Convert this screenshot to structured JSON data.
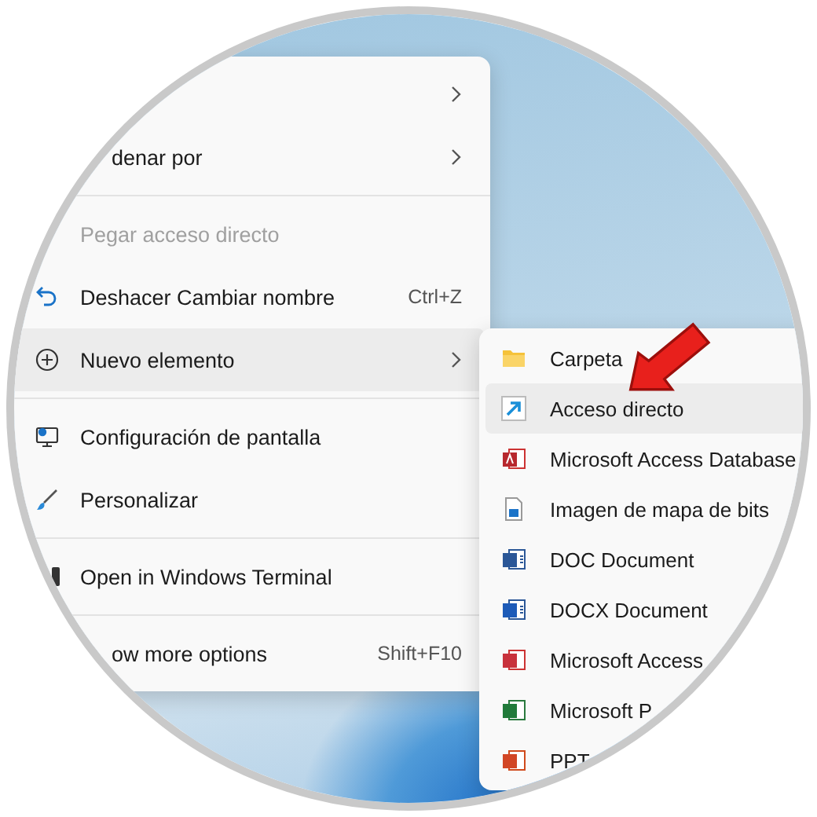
{
  "context_menu": {
    "items": [
      {
        "kind": "item",
        "disabled": false,
        "selected": false,
        "submenu": true
      },
      {
        "kind": "partial",
        "label": "denar por",
        "disabled": false,
        "selected": false,
        "submenu": true
      },
      {
        "kind": "separator"
      },
      {
        "kind": "item",
        "label": "Pegar acceso directo",
        "disabled": true,
        "selected": false,
        "submenu": false
      },
      {
        "kind": "item",
        "label": "Deshacer Cambiar nombre",
        "shortcut": "Ctrl+Z",
        "disabled": false,
        "selected": false,
        "submenu": false
      },
      {
        "kind": "item",
        "label": "Nuevo elemento",
        "disabled": false,
        "selected": true,
        "submenu": true
      },
      {
        "kind": "separator"
      },
      {
        "kind": "item",
        "label": "Configuración de pantalla",
        "disabled": false,
        "selected": false,
        "submenu": false
      },
      {
        "kind": "item",
        "label": "Personalizar",
        "disabled": false,
        "selected": false,
        "submenu": false
      },
      {
        "kind": "separator"
      },
      {
        "kind": "item",
        "label": "Open in Windows Terminal",
        "disabled": false,
        "selected": false,
        "submenu": false
      },
      {
        "kind": "separator"
      },
      {
        "kind": "partial",
        "label": "ow more options",
        "shortcut": "Shift+F10",
        "disabled": false,
        "selected": false,
        "submenu": false
      }
    ]
  },
  "new_submenu": {
    "items": [
      {
        "label": "Carpeta",
        "selected": false
      },
      {
        "label": "Acceso directo",
        "selected": true
      },
      {
        "label": "Microsoft Access Database",
        "selected": false
      },
      {
        "label": "Imagen de mapa de bits",
        "selected": false
      },
      {
        "label": "DOC Document",
        "selected": false
      },
      {
        "label": "DOCX Document",
        "selected": false
      },
      {
        "label": "Microsoft Access",
        "selected": false
      },
      {
        "label": "Microsoft P",
        "selected": false
      },
      {
        "label": "PPT",
        "selected": false
      }
    ]
  }
}
